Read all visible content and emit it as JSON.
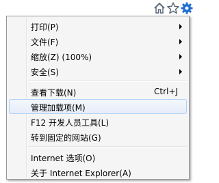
{
  "toolbar": {
    "icons": [
      "home-icon",
      "favorites-star-icon",
      "tools-gear-icon"
    ],
    "accent": "#1e6fcf"
  },
  "menu": {
    "items": [
      {
        "label": "打印(P)",
        "submenu": true
      },
      {
        "label": "文件(F)",
        "submenu": true
      },
      {
        "label": "缩放(Z) (100%)",
        "submenu": true
      },
      {
        "label": "安全(S)",
        "submenu": true
      },
      {
        "label": "查看下载(N)",
        "shortcut": "Ctrl+J"
      },
      {
        "label": "管理加载项(M)",
        "highlighted": true
      },
      {
        "label": "F12 开发人员工具(L)"
      },
      {
        "label": "转到固定的网站(G)"
      },
      {
        "label": "Internet 选项(O)"
      },
      {
        "label": "关于 Internet Explorer(A)"
      }
    ]
  }
}
